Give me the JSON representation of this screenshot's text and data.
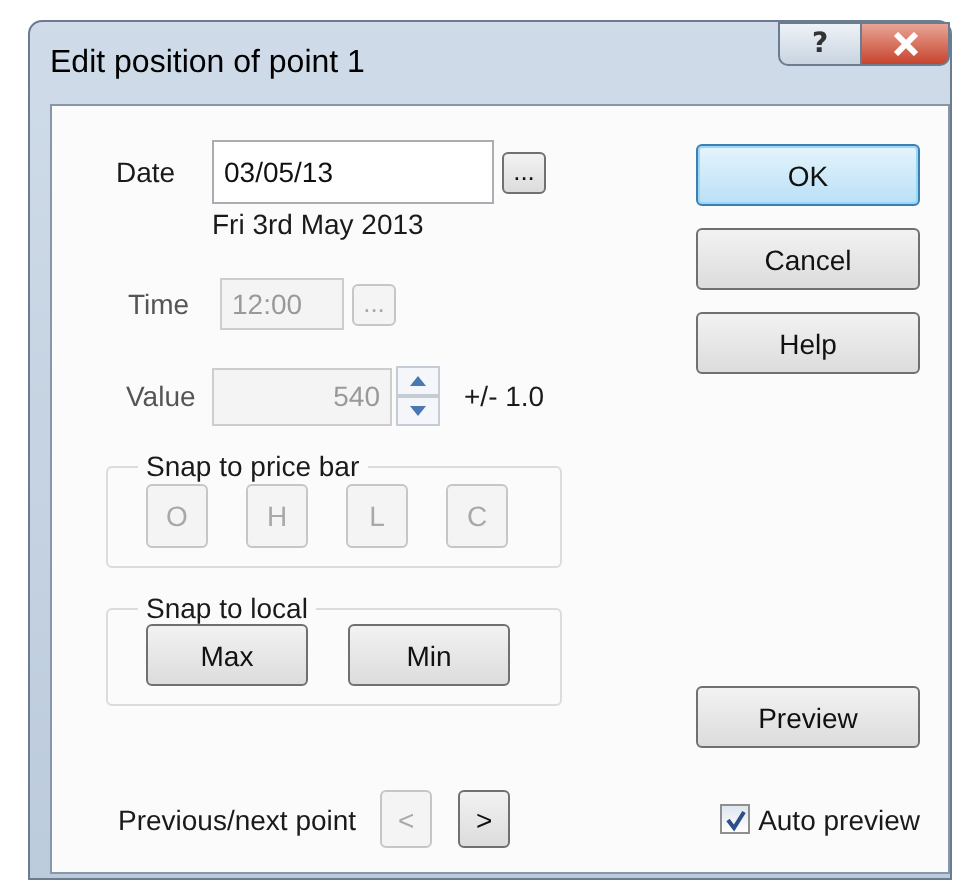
{
  "window": {
    "title": "Edit position of point 1",
    "help_button": "?"
  },
  "date": {
    "label": "Date",
    "value": "03/05/13",
    "browse": "...",
    "long_date": "Fri 3rd May 2013"
  },
  "time": {
    "label": "Time",
    "value": "12:00",
    "browse": "...",
    "disabled": true
  },
  "value": {
    "label": "Value",
    "value": "540",
    "tolerance": "+/- 1.0",
    "disabled": true
  },
  "snap_price_bar": {
    "title": "Snap to price bar",
    "buttons": [
      {
        "label": "O",
        "disabled": true
      },
      {
        "label": "H",
        "disabled": true
      },
      {
        "label": "L",
        "disabled": true
      },
      {
        "label": "C",
        "disabled": true
      }
    ]
  },
  "snap_local": {
    "title": "Snap to local",
    "buttons": [
      {
        "label": "Max",
        "disabled": false
      },
      {
        "label": "Min",
        "disabled": false
      }
    ]
  },
  "navigation": {
    "label": "Previous/next point",
    "buttons": [
      {
        "label": "<",
        "disabled": true
      },
      {
        "label": ">",
        "disabled": false
      }
    ]
  },
  "actions": [
    {
      "label": "OK",
      "default": true
    },
    {
      "label": "Cancel",
      "default": false
    },
    {
      "label": "Help",
      "default": false
    }
  ],
  "preview": {
    "label": "Preview"
  },
  "auto_preview": {
    "label": "Auto preview",
    "checked": true
  }
}
